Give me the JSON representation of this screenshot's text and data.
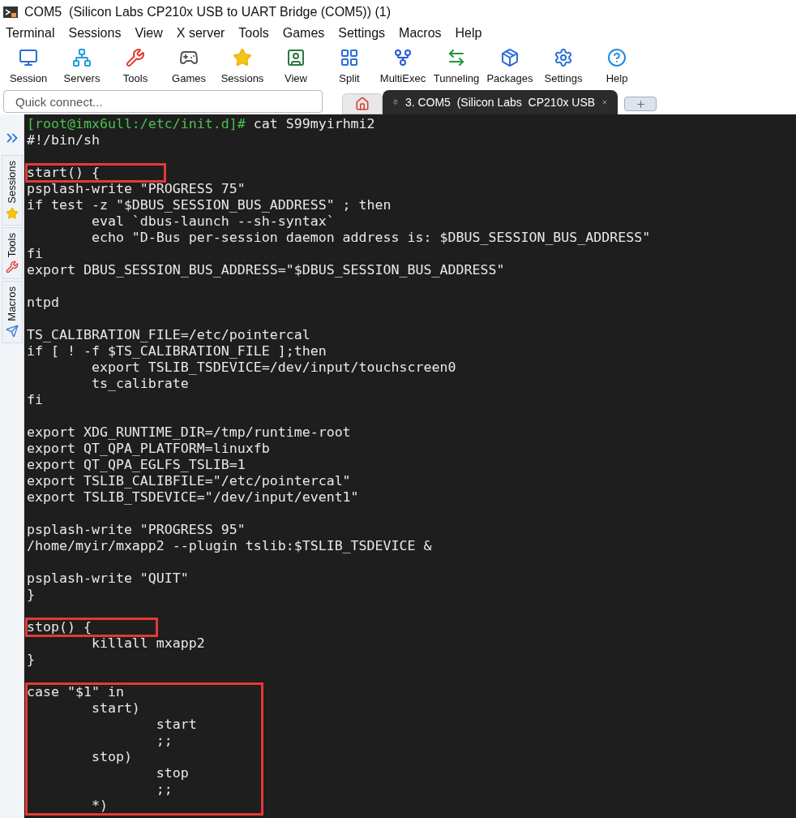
{
  "window": {
    "title": "COM5  (Silicon Labs CP210x USB to UART Bridge (COM5)) (1)"
  },
  "menu": [
    "Terminal",
    "Sessions",
    "View",
    "X server",
    "Tools",
    "Games",
    "Settings",
    "Macros",
    "Help"
  ],
  "toolbar": [
    {
      "kind": "session",
      "label": "Session"
    },
    {
      "kind": "servers",
      "label": "Servers"
    },
    {
      "kind": "tools",
      "label": "Tools"
    },
    {
      "kind": "games",
      "label": "Games"
    },
    {
      "kind": "sessions",
      "label": "Sessions"
    },
    {
      "kind": "view",
      "label": "View"
    },
    {
      "kind": "split",
      "label": "Split"
    },
    {
      "kind": "multiexec",
      "label": "MultiExec"
    },
    {
      "kind": "tunneling",
      "label": "Tunneling"
    },
    {
      "kind": "packages",
      "label": "Packages"
    },
    {
      "kind": "settings",
      "label": "Settings"
    },
    {
      "kind": "help",
      "label": "Help"
    }
  ],
  "quick_connect": {
    "placeholder": "Quick connect..."
  },
  "tabs": [
    {
      "kind": "home",
      "selected": false
    },
    {
      "kind": "session",
      "label": "3. COM5  (Silicon Labs  CP210x USB",
      "selected": true
    },
    {
      "kind": "new",
      "selected": false
    }
  ],
  "side_tabs": [
    {
      "kind": "sessions",
      "label": "Sessions"
    },
    {
      "kind": "tools",
      "label": "Tools"
    },
    {
      "kind": "macros",
      "label": "Macros"
    }
  ],
  "terminal": {
    "prompt": "[root@imx6ull:/etc/init.d]#",
    "command": " cat S99myirhmi2",
    "paragraphs": [
      {
        "segments": [
          {
            "boxed": false,
            "lines": [
              "#!/bin/sh"
            ]
          }
        ]
      },
      {
        "segments": [
          {
            "boxed": true,
            "lines": [
              "start() {"
            ]
          },
          {
            "boxed": false,
            "lines": [
              "psplash-write \"PROGRESS 75\"",
              "if test -z \"$DBUS_SESSION_BUS_ADDRESS\" ; then",
              "        eval `dbus-launch --sh-syntax`",
              "        echo \"D-Bus per-session daemon address is: $DBUS_SESSION_BUS_ADDRESS\"",
              "fi",
              "export DBUS_SESSION_BUS_ADDRESS=\"$DBUS_SESSION_BUS_ADDRESS\""
            ]
          }
        ]
      },
      {
        "segments": [
          {
            "boxed": false,
            "lines": [
              "ntpd"
            ]
          }
        ]
      },
      {
        "segments": [
          {
            "boxed": false,
            "lines": [
              "TS_CALIBRATION_FILE=/etc/pointercal",
              "if [ ! -f $TS_CALIBRATION_FILE ];then",
              "        export TSLIB_TSDEVICE=/dev/input/touchscreen0",
              "        ts_calibrate",
              "fi"
            ]
          }
        ]
      },
      {
        "segments": [
          {
            "boxed": false,
            "lines": [
              "export XDG_RUNTIME_DIR=/tmp/runtime-root",
              "export QT_QPA_PLATFORM=linuxfb",
              "export QT_QPA_EGLFS_TSLIB=1",
              "export TSLIB_CALIBFILE=\"/etc/pointercal\"",
              "export TSLIB_TSDEVICE=\"/dev/input/event1\""
            ]
          }
        ]
      },
      {
        "segments": [
          {
            "boxed": false,
            "lines": [
              "psplash-write \"PROGRESS 95\"",
              "/home/myir/mxapp2 --plugin tslib:$TSLIB_TSDEVICE &"
            ]
          }
        ]
      },
      {
        "segments": [
          {
            "boxed": false,
            "lines": [
              "psplash-write \"QUIT\"",
              "}"
            ]
          }
        ]
      },
      {
        "segments": [
          {
            "boxed": true,
            "lines": [
              "stop() {"
            ]
          },
          {
            "boxed": false,
            "lines": [
              "        killall mxapp2",
              "}"
            ]
          }
        ]
      },
      {
        "segments": [
          {
            "boxed": true,
            "lines": [
              "case \"$1\" in",
              "        start)",
              "                start",
              "                ;;",
              "        stop)",
              "                stop",
              "                ;;",
              "        *)"
            ]
          }
        ]
      }
    ]
  }
}
